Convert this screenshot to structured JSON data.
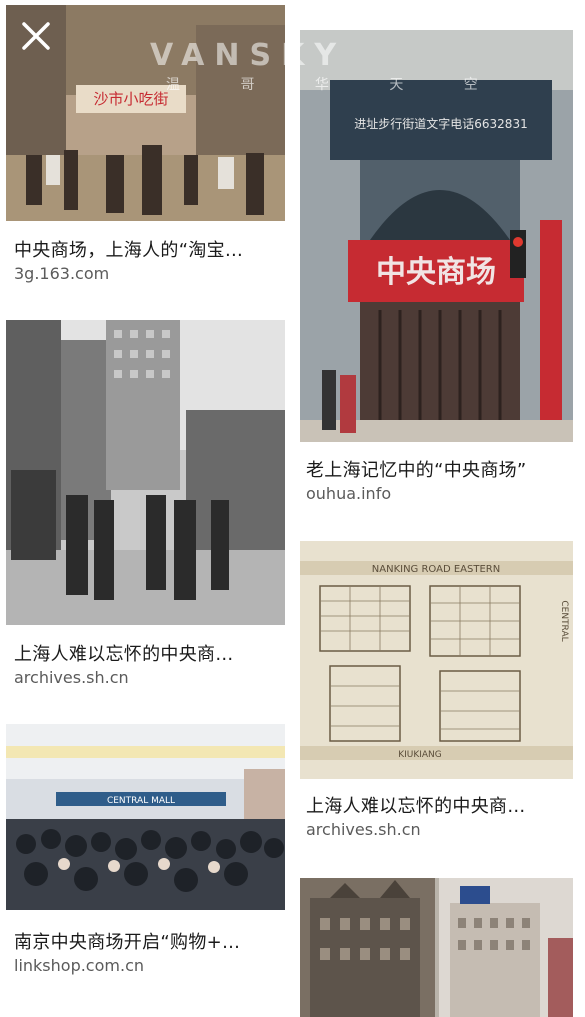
{
  "watermark": {
    "brand": "VANSKY",
    "sub": "温 哥 华 天 空"
  },
  "results": [
    {
      "caption": "中央商场，上海人的“淘宝…",
      "source": "3g.163.com"
    },
    {
      "caption": "老上海记忆中的“中央商场”",
      "source": "ouhua.info"
    },
    {
      "caption": "上海人难以忘怀的中央商…",
      "source": "archives.sh.cn"
    },
    {
      "caption": "上海人难以忘怀的中央商…",
      "source": "archives.sh.cn"
    },
    {
      "caption": "南京中央商场开启“购物+…",
      "source": "linkshop.com.cn"
    }
  ],
  "image_text": {
    "shop_sign": "中央商场",
    "top_banner": "进址步行街道文字电话6632831",
    "map_street_1": "NANKING ROAD EASTERN",
    "map_street_2": "KIUKIANG",
    "map_street_3": "CENTRAL",
    "market_sign": "沙市小吃街",
    "mall_sign": "CENTRAL MALL"
  },
  "colors": {
    "caption": "#1b1b1b",
    "source": "#5b5b5b",
    "accent_red": "#c62b32"
  }
}
